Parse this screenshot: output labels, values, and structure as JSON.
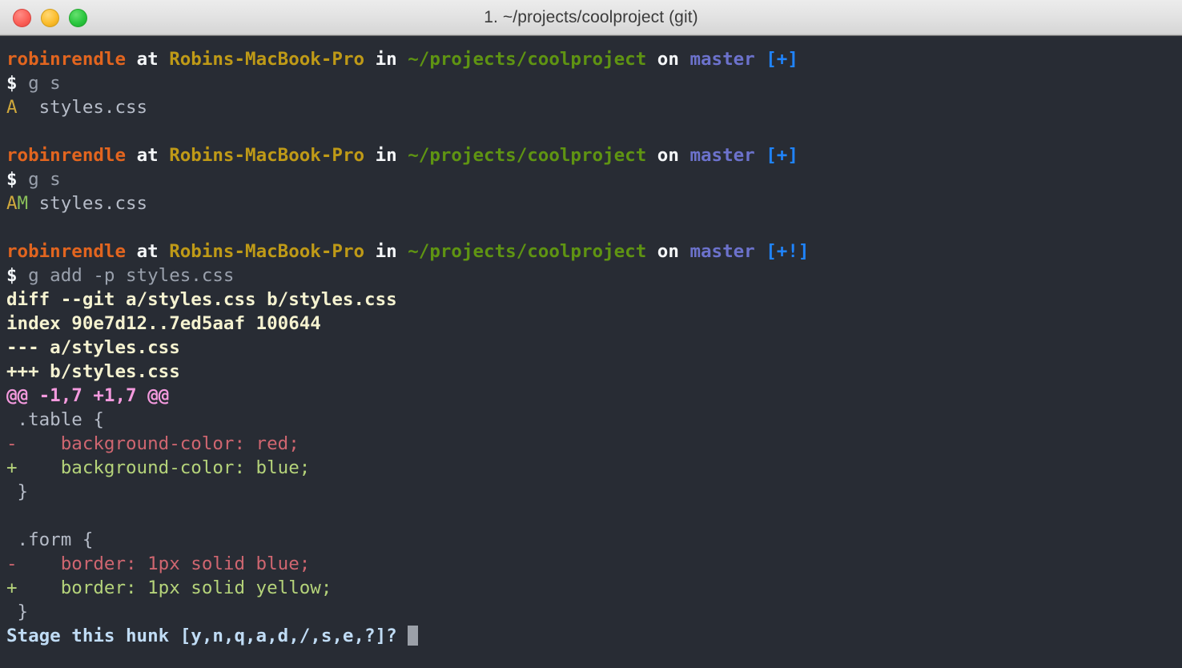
{
  "window": {
    "title": "1. ~/projects/coolproject (git)",
    "traffic_lights": [
      {
        "name": "close",
        "color": "#fb6159"
      },
      {
        "name": "minimize",
        "color": "#fbbd2e"
      },
      {
        "name": "maximize",
        "color": "#2bc73f"
      }
    ]
  },
  "theme": {
    "background": "#282c34",
    "foreground": "#b6bcc8",
    "user": "#e2651f",
    "host": "#bf9a17",
    "path": "#5f9412",
    "branch": "#6c72cc",
    "dirty": "#1f84ff",
    "diff_header": "#f5f2d0",
    "hunk_header": "#f49ade",
    "deleted": "#cf6670",
    "inserted": "#b5d37a",
    "prompt_question": "#c0dcf5",
    "cursor": "#9ba0a8"
  },
  "prompt": {
    "user": "robinrendle",
    "at": "at",
    "host": "Robins-MacBook-Pro",
    "in": "in",
    "path": "~/projects/coolproject",
    "on": "on",
    "branch": "master",
    "dirty_clean": "[+]",
    "dirty_staged": "[+!]",
    "sigil": "$"
  },
  "commands": {
    "status": "g s",
    "add_patch": "g add -p styles.css"
  },
  "status_output": {
    "first": {
      "flag_added": "A",
      "flag_modified": " ",
      "file": "styles.css"
    },
    "second": {
      "flag_added": "A",
      "flag_modified": "M",
      "file": "styles.css"
    }
  },
  "diff": {
    "header_lines": [
      "diff --git a/styles.css b/styles.css",
      "index 90e7d12..7ed5aaf 100644",
      "--- a/styles.css",
      "+++ b/styles.css"
    ],
    "hunk_header": "@@ -1,7 +1,7 @@",
    "lines": [
      {
        "kind": "context",
        "text": " .table {"
      },
      {
        "kind": "deleted",
        "text": "-    background-color: red;"
      },
      {
        "kind": "inserted",
        "text": "+    background-color: blue;"
      },
      {
        "kind": "context",
        "text": " }"
      },
      {
        "kind": "context",
        "text": " "
      },
      {
        "kind": "context",
        "text": " .form {"
      },
      {
        "kind": "deleted",
        "text": "-    border: 1px solid blue;"
      },
      {
        "kind": "inserted",
        "text": "+    border: 1px solid yellow;"
      },
      {
        "kind": "context",
        "text": " }"
      }
    ]
  },
  "interactive_prompt": {
    "question": "Stage this hunk [y,n,q,a,d,/,s,e,?]?"
  }
}
